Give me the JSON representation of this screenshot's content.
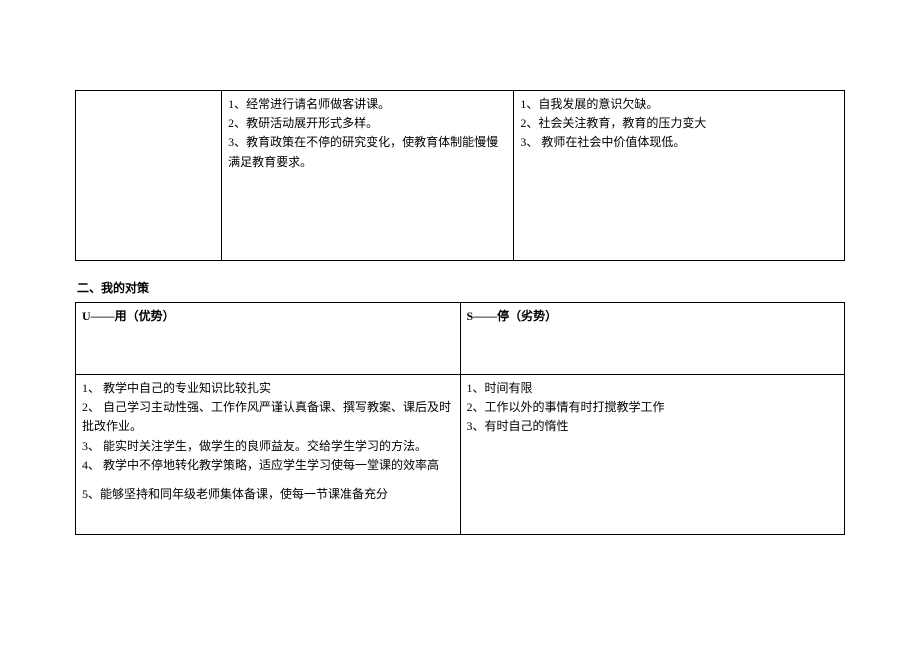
{
  "table1": {
    "col1": "",
    "col2": [
      "1、经常进行请名师做客讲课。",
      "2、教研活动展开形式多样。",
      "3、教育政策在不停的研究变化，使教育体制能慢慢满足教育要求。"
    ],
    "col3": [
      "1、自我发展的意识欠缺。",
      "2、社会关注教育，教育的压力变大",
      "3、  教师在社会中价值体现低。"
    ]
  },
  "section2": {
    "title": "二、我的对策",
    "header_left": "U——用（优势）",
    "header_right": "S——停（劣势）",
    "left_items": [
      "1、  教学中自己的专业知识比较扎实",
      "2、  自己学习主动性强、工作作风严谨认真备课、撰写教案、课后及时批改作业。",
      "3、  能实时关注学生，做学生的良师益友。交给学生学习的方法。",
      "4、  教学中不停地转化教学策略，适应学生学习使每一堂课的效率高",
      "",
      "5、能够坚持和同年级老师集体备课，使每一节课准备充分"
    ],
    "right_items": [
      "1、时间有限",
      "2、工作以外的事情有时打搅教学工作",
      "3、有时自己的惰性"
    ]
  }
}
